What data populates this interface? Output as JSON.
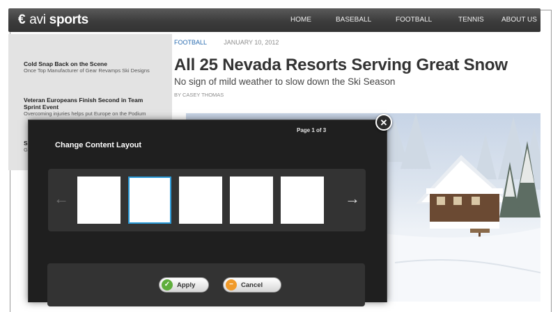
{
  "brand": {
    "mark": "€",
    "name_light": "avi",
    "name_bold": "sports"
  },
  "nav": {
    "items": [
      "HOME",
      "BASEBALL",
      "FOOTBALL",
      "TENNIS",
      "ABOUT US"
    ]
  },
  "sidebar": {
    "items": [
      {
        "title": "Cold Snap Back on the Scene",
        "subtitle": "Once Top Manufacturer of Gear Revamps Ski Designs"
      },
      {
        "title": "Veteran Europeans Finish Second in Team Sprint Event",
        "subtitle": "Overcoming injuries helps put Europe on the Podium"
      },
      {
        "title": "S",
        "subtitle": "G E"
      }
    ]
  },
  "article": {
    "category": "FOOTBALL",
    "date": "JANUARY 10, 2012",
    "headline": "All 25 Nevada Resorts Serving Great Snow",
    "subheadline": "No sign of mild weather to slow down the Ski Season",
    "byline": "BY CASEY THOMAS"
  },
  "modal": {
    "title": "Change Content Layout",
    "page_indicator": "Page 1 of 3",
    "apply_label": "Apply",
    "cancel_label": "Cancel",
    "close_glyph": "✕",
    "prev_glyph": "←",
    "next_glyph": "→",
    "layout_options_count": 5,
    "selected_layout_index": 2
  },
  "colors": {
    "accent": "#2a9ad8",
    "category_link": "#2a6cb0",
    "apply_icon": "#5fae3c",
    "cancel_icon": "#f09a2a",
    "topbar": "#3c3c3c",
    "modal_bg": "#1f1f1f"
  },
  "icons": {
    "logo": "logo-mark-icon",
    "close": "close-icon",
    "prev": "arrow-left-icon",
    "next": "arrow-right-icon",
    "apply": "check-icon",
    "cancel": "minus-icon"
  }
}
